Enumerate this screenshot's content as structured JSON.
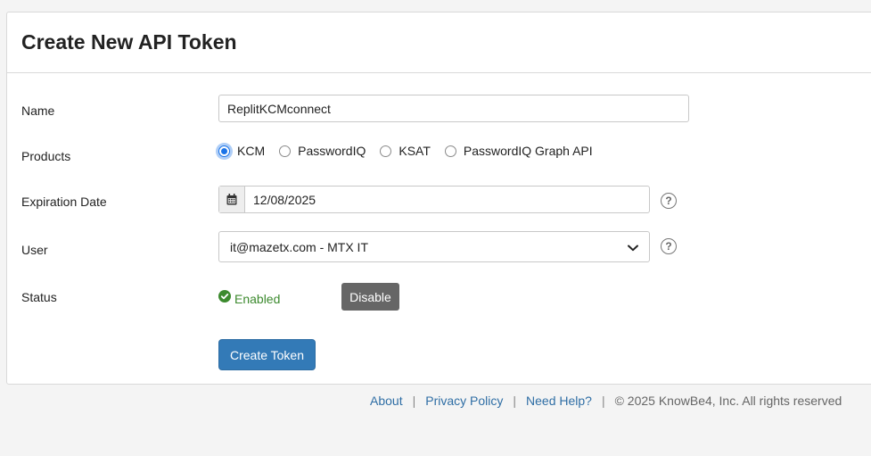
{
  "form": {
    "title": "Create New API Token",
    "name": {
      "label": "Name",
      "value": "ReplitKCMconnect"
    },
    "products": {
      "label": "Products",
      "options": [
        {
          "label": "KCM",
          "checked": true
        },
        {
          "label": "PasswordIQ",
          "checked": false
        },
        {
          "label": "KSAT",
          "checked": false
        },
        {
          "label": "PasswordIQ Graph API",
          "checked": false
        }
      ]
    },
    "expiration": {
      "label": "Expiration Date",
      "value": "12/08/2025",
      "help_icon": "question-circle-icon",
      "calendar_icon": "calendar-icon"
    },
    "user": {
      "label": "User",
      "value": "it@mazetx.com - MTX IT",
      "help_icon": "question-circle-icon",
      "chevron_icon": "chevron-down-icon"
    },
    "status": {
      "label": "Status",
      "value": "Enabled",
      "icon": "check-circle-icon",
      "color": "#3c8a2e",
      "disable_label": "Disable"
    },
    "create_label": "Create Token"
  },
  "footer": {
    "links": [
      "About",
      "Privacy Policy",
      "Need Help?"
    ],
    "copyright": "© 2025 KnowBe4, Inc. All rights reserved"
  },
  "colors": {
    "primary": "#337ab7",
    "link": "#2f6ea5",
    "disable_button": "#666666",
    "radio_accent": "#1a73e8"
  }
}
